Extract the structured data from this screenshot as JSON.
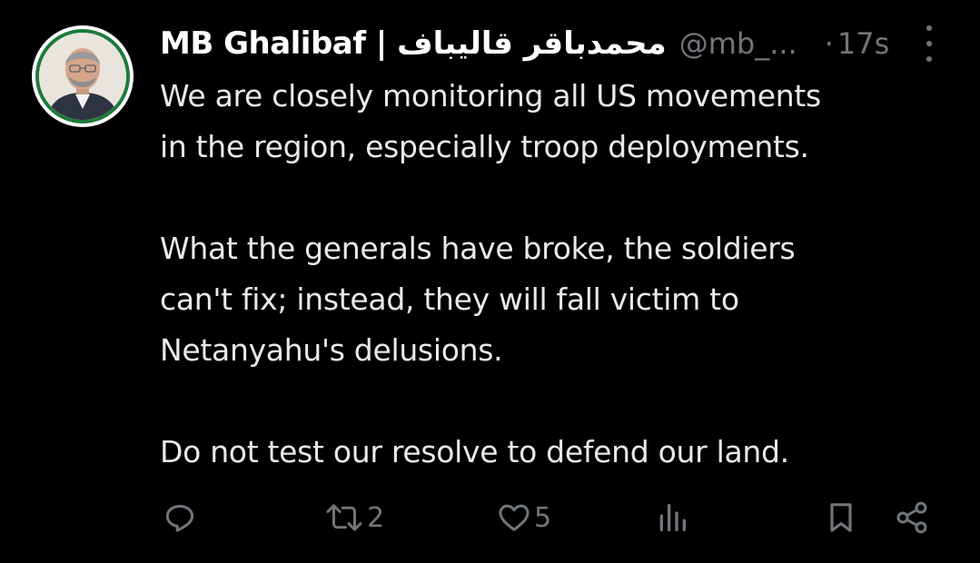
{
  "tweet": {
    "author_name": "MB Ghalibaf | محمدباقر قالیباف",
    "handle": "@mb_...",
    "separator": "·",
    "time": "17s",
    "paragraphs": [
      [
        "We are closely monitoring all US movements",
        "in the region, especially troop deployments."
      ],
      [
        "What the generals have broke, the soldiers",
        "can't fix; instead, they will fall victim to",
        "Netanyahu's delusions."
      ],
      [
        "Do not test our resolve to defend our land."
      ]
    ]
  },
  "actions": {
    "reply_icon": "reply-icon",
    "retweet_icon": "retweet-icon",
    "retweet_count": "2",
    "like_icon": "heart-icon",
    "like_count": "5",
    "views_icon": "views-chart-icon",
    "bookmark_icon": "bookmark-icon",
    "share_icon": "share-icon"
  },
  "colors": {
    "background": "#000000",
    "text": "#e7e9ea",
    "muted": "#71767b",
    "avatar_ring": "#1e7a3c"
  }
}
